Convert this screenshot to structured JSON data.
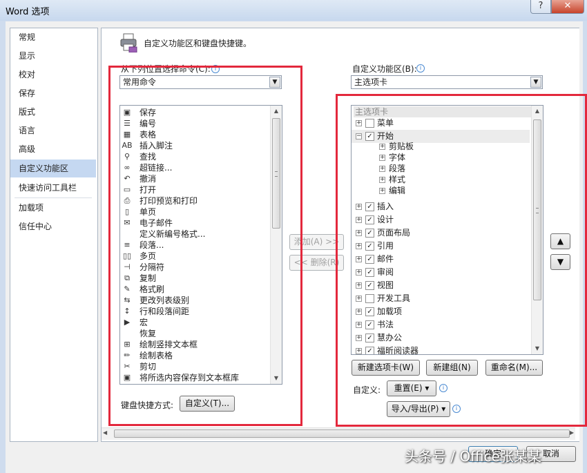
{
  "window": {
    "title": "Word 选项",
    "help_label": "?",
    "close_label": "✕"
  },
  "nav": {
    "items": [
      {
        "label": "常规"
      },
      {
        "label": "显示"
      },
      {
        "label": "校对"
      },
      {
        "label": "保存"
      },
      {
        "label": "版式"
      },
      {
        "label": "语言"
      },
      {
        "label": "高级"
      },
      {
        "label": "自定义功能区"
      },
      {
        "label": "快速访问工具栏"
      },
      {
        "label": "加载项"
      },
      {
        "label": "信任中心"
      }
    ],
    "selected": "自定义功能区"
  },
  "header": {
    "text": "自定义功能区和键盘快捷键。"
  },
  "left": {
    "choose_label": "从下列位置选择命令(C):",
    "choose_value": "常用命令",
    "commands": [
      {
        "icon": "save-icon",
        "glyph": "▣",
        "label": "保存"
      },
      {
        "icon": "numbering-icon",
        "glyph": "☰",
        "label": "编号",
        "sub": "▸"
      },
      {
        "icon": "table-icon",
        "glyph": "▦",
        "label": "表格",
        "sub": "▸"
      },
      {
        "icon": "insert-footnote-icon",
        "glyph": "AB",
        "label": "插入脚注"
      },
      {
        "icon": "find-icon",
        "glyph": "⚲",
        "label": "查找"
      },
      {
        "icon": "hyperlink-icon",
        "glyph": "∞",
        "label": "超链接..."
      },
      {
        "icon": "undo-icon",
        "glyph": "↶",
        "label": "撤消",
        "sub": "▸"
      },
      {
        "icon": "open-icon",
        "glyph": "▭",
        "label": "打开"
      },
      {
        "icon": "print-preview-icon",
        "glyph": "⎙",
        "label": "打印预览和打印"
      },
      {
        "icon": "single-page-icon",
        "glyph": "▯",
        "label": "单页"
      },
      {
        "icon": "email-icon",
        "glyph": "✉",
        "label": "电子邮件"
      },
      {
        "icon": "new-number-format-icon",
        "glyph": "",
        "label": "定义新编号格式..."
      },
      {
        "icon": "paragraph-icon",
        "glyph": "≡",
        "label": "段落..."
      },
      {
        "icon": "multiple-pages-icon",
        "glyph": "▯▯",
        "label": "多页"
      },
      {
        "icon": "breaks-icon",
        "glyph": "⊣",
        "label": "分隔符",
        "sub": "▸"
      },
      {
        "icon": "copy-icon",
        "glyph": "⧉",
        "label": "复制"
      },
      {
        "icon": "format-painter-icon",
        "glyph": "✎",
        "label": "格式刷"
      },
      {
        "icon": "list-level-icon",
        "glyph": "⇆",
        "label": "更改列表级别",
        "sub": "▸"
      },
      {
        "icon": "line-spacing-icon",
        "glyph": "↕",
        "label": "行和段落间距",
        "sub": "▸"
      },
      {
        "icon": "macro-icon",
        "glyph": "▶",
        "label": "宏"
      },
      {
        "icon": "redo-icon",
        "glyph": "",
        "label": "恢复"
      },
      {
        "icon": "vertical-textbox-icon",
        "glyph": "⊞",
        "label": "绘制竖排文本框"
      },
      {
        "icon": "draw-table-icon",
        "glyph": "✏",
        "label": "绘制表格"
      },
      {
        "icon": "cut-icon",
        "glyph": "✂",
        "label": "剪切"
      },
      {
        "icon": "save-to-textbox-icon",
        "glyph": "▣",
        "label": "将所选内容保存到文本框库"
      }
    ],
    "shortcut_label": "键盘快捷方式:",
    "customize_button": "自定义(T)..."
  },
  "middle": {
    "add_button": "添加(A) >>",
    "remove_button": "<< 删除(R)"
  },
  "right": {
    "ribbon_label": "自定义功能区(B):",
    "ribbon_value": "主选项卡",
    "tree_header": "主选项卡",
    "tabs": [
      {
        "label": "菜单",
        "checked": false,
        "expanded": false
      },
      {
        "label": "开始",
        "checked": true,
        "expanded": true,
        "groups": [
          "剪贴板",
          "字体",
          "段落",
          "样式",
          "编辑"
        ]
      },
      {
        "label": "插入",
        "checked": true,
        "expanded": false
      },
      {
        "label": "设计",
        "checked": true,
        "expanded": false
      },
      {
        "label": "页面布局",
        "checked": true,
        "expanded": false
      },
      {
        "label": "引用",
        "checked": true,
        "expanded": false
      },
      {
        "label": "邮件",
        "checked": true,
        "expanded": false
      },
      {
        "label": "审阅",
        "checked": true,
        "expanded": false
      },
      {
        "label": "视图",
        "checked": true,
        "expanded": false
      },
      {
        "label": "开发工具",
        "checked": false,
        "expanded": false
      },
      {
        "label": "加载项",
        "checked": true,
        "expanded": false
      },
      {
        "label": "书法",
        "checked": true,
        "expanded": false
      },
      {
        "label": "慧办公",
        "checked": true,
        "expanded": false
      },
      {
        "label": "福昕阅读器",
        "checked": true,
        "expanded": false
      }
    ],
    "new_tab_button": "新建选项卡(W)",
    "new_group_button": "新建组(N)",
    "rename_button": "重命名(M)...",
    "customize_label": "自定义:",
    "reset_button": "重置(E) ▾",
    "import_export_button": "导入/导出(P) ▾",
    "move_up": "▲",
    "move_down": "▼"
  },
  "footer": {
    "ok_button": "确定",
    "cancel_button": "取消"
  },
  "watermark": "头条号 / Office张某某",
  "colors": {
    "highlight_box": "#e3283c",
    "nav_selected": "#c5d8f1"
  }
}
